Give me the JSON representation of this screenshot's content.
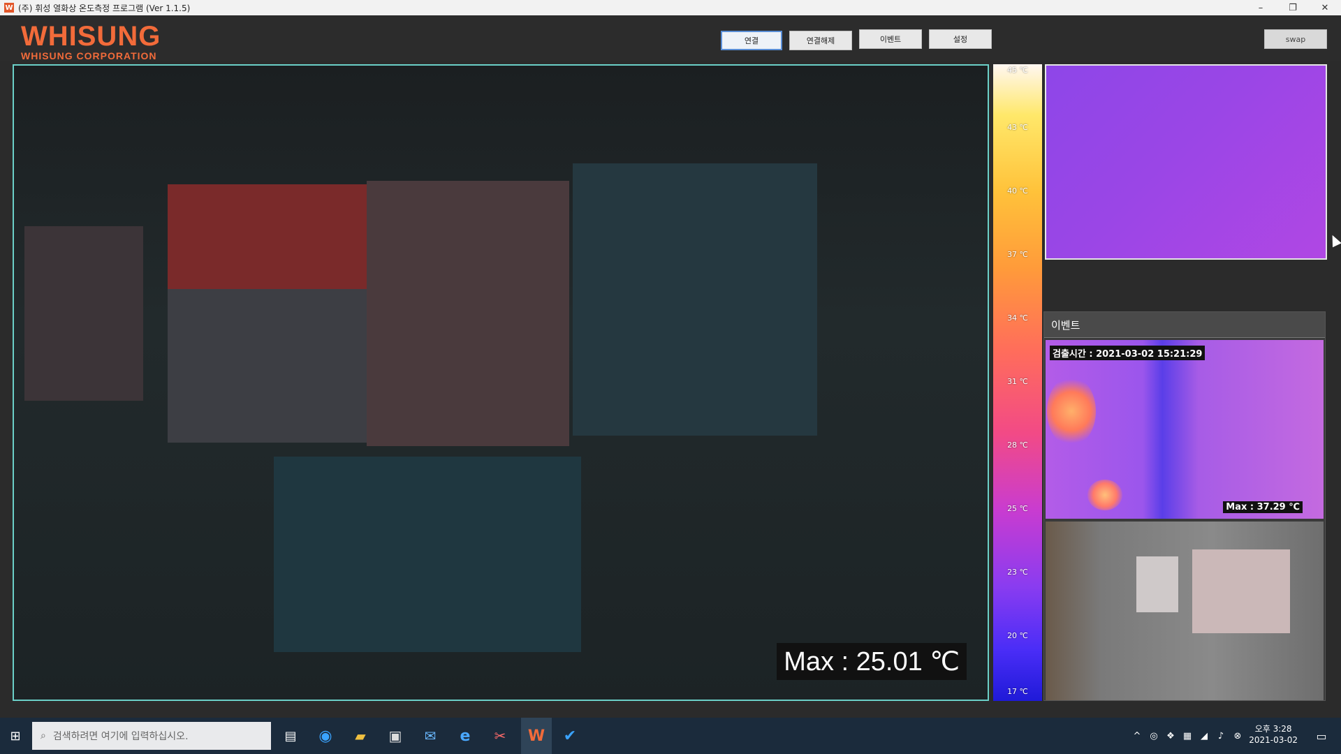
{
  "window": {
    "title": "(주) 휘성 열화상 온도측정 프로그램 (Ver 1.1.5)",
    "controls": [
      "minimize",
      "restore",
      "close"
    ]
  },
  "brand": {
    "logo_main": "WHISUNG",
    "logo_sub": "WHISUNG CORPORATION",
    "accent": "#f26b3a"
  },
  "toolbar": {
    "connect": "연결",
    "disconnect": "연결해제",
    "event": "이벤트",
    "settings": "설정",
    "swap": "swap"
  },
  "main_view": {
    "max_label": "Max : 25.01 ℃"
  },
  "scale": {
    "ticks": [
      "45 ℃",
      "43 ℃",
      "40 ℃",
      "37 ℃",
      "34 ℃",
      "31 ℃",
      "28 ℃",
      "25 ℃",
      "23 ℃",
      "20 ℃",
      "17 ℃"
    ]
  },
  "event_panel": {
    "title": "이벤트",
    "detect_time": "검출시간 : 2021-03-02 15:21:29",
    "max": "Max : 37.29 ℃"
  },
  "taskbar": {
    "search_placeholder": "검색하려면 여기에 입력하십시오.",
    "time": "오후 3:28",
    "date": "2021-03-02"
  }
}
